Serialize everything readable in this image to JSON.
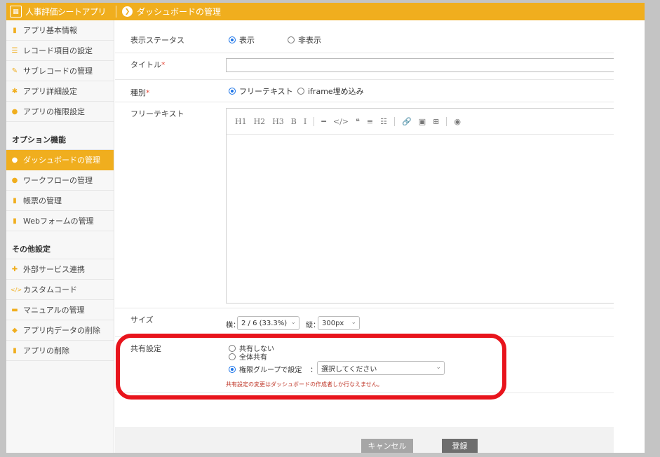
{
  "header": {
    "app_title": "人事評価シートアプリ",
    "app_icon_glyph": "▦",
    "page_title": "ダッシュボードの管理",
    "page_icon_glyph": "❯"
  },
  "sidebar": {
    "items_top": [
      {
        "label": "アプリ基本情報",
        "icon": "info-icon",
        "glyph": "▮"
      },
      {
        "label": "レコード項目の設定",
        "icon": "list-icon",
        "glyph": "☰"
      },
      {
        "label": "サブレコードの管理",
        "icon": "pen-icon",
        "glyph": "✎"
      },
      {
        "label": "アプリ詳細設定",
        "icon": "gear-icon",
        "glyph": "✱"
      },
      {
        "label": "アプリの権限設定",
        "icon": "users-icon",
        "glyph": "●"
      }
    ],
    "section_options": "オプション機能",
    "items_options": [
      {
        "label": "ダッシュボードの管理",
        "icon": "dashboard-icon",
        "glyph": "●",
        "active": true
      },
      {
        "label": "ワークフローの管理",
        "icon": "workflow-icon",
        "glyph": "●"
      },
      {
        "label": "帳票の管理",
        "icon": "document-icon",
        "glyph": "▮"
      },
      {
        "label": "Webフォームの管理",
        "icon": "form-icon",
        "glyph": "▮"
      }
    ],
    "section_other": "その他設定",
    "items_other": [
      {
        "label": "外部サービス連携",
        "icon": "puzzle-icon",
        "glyph": "✚"
      },
      {
        "label": "カスタムコード",
        "icon": "code-icon",
        "glyph": "</>"
      },
      {
        "label": "マニュアルの管理",
        "icon": "book-icon",
        "glyph": "▬"
      },
      {
        "label": "アプリ内データの削除",
        "icon": "eraser-icon",
        "glyph": "◆"
      },
      {
        "label": "アプリの削除",
        "icon": "trash-icon",
        "glyph": "▮"
      }
    ]
  },
  "form": {
    "status": {
      "label": "表示ステータス",
      "options": [
        "表示",
        "非表示"
      ],
      "selected": 0
    },
    "title": {
      "label": "タイトル",
      "required_mark": "*",
      "value": ""
    },
    "kind": {
      "label": "種別",
      "required_mark": "*",
      "options": [
        "フリーテキスト",
        "iframe埋め込み"
      ],
      "selected": 0
    },
    "free_text": {
      "label": "フリーテキスト",
      "toolbar": [
        "H1",
        "H2",
        "H3",
        "B",
        "I",
        "|",
        "━",
        "</>",
        "❝",
        "≡",
        "☷",
        "|",
        "🔗",
        "▣",
        "⊞",
        "|",
        "◉"
      ],
      "toolbar_names": [
        "h1-icon",
        "h2-icon",
        "h3-icon",
        "bold-icon",
        "italic-icon",
        "sep",
        "hr-icon",
        "code-icon",
        "quote-icon",
        "ordered-list-icon",
        "bullet-list-icon",
        "sep",
        "link-icon",
        "image-icon",
        "table-icon",
        "sep",
        "preview-icon"
      ]
    },
    "size": {
      "label": "サイズ",
      "width_label": "横：",
      "width_value": "2 / 6 (33.3%)",
      "height_label": "縦：",
      "height_value": "300px"
    },
    "sharing": {
      "label": "共有設定",
      "options": [
        "共有しない",
        "全体共有",
        "権限グループで設定"
      ],
      "selected": 2,
      "group_separator": "：",
      "group_select_value": "選択してください",
      "note": "共有設定の変更はダッシュボードの作成者しか行なえません。"
    }
  },
  "footer": {
    "cancel_label": "キャンセル",
    "submit_label": "登録"
  },
  "colors": {
    "accent": "#f0ae1e",
    "highlight": "#e8141c",
    "cancel": "#a6a6a6",
    "submit": "#6e6e6e"
  }
}
